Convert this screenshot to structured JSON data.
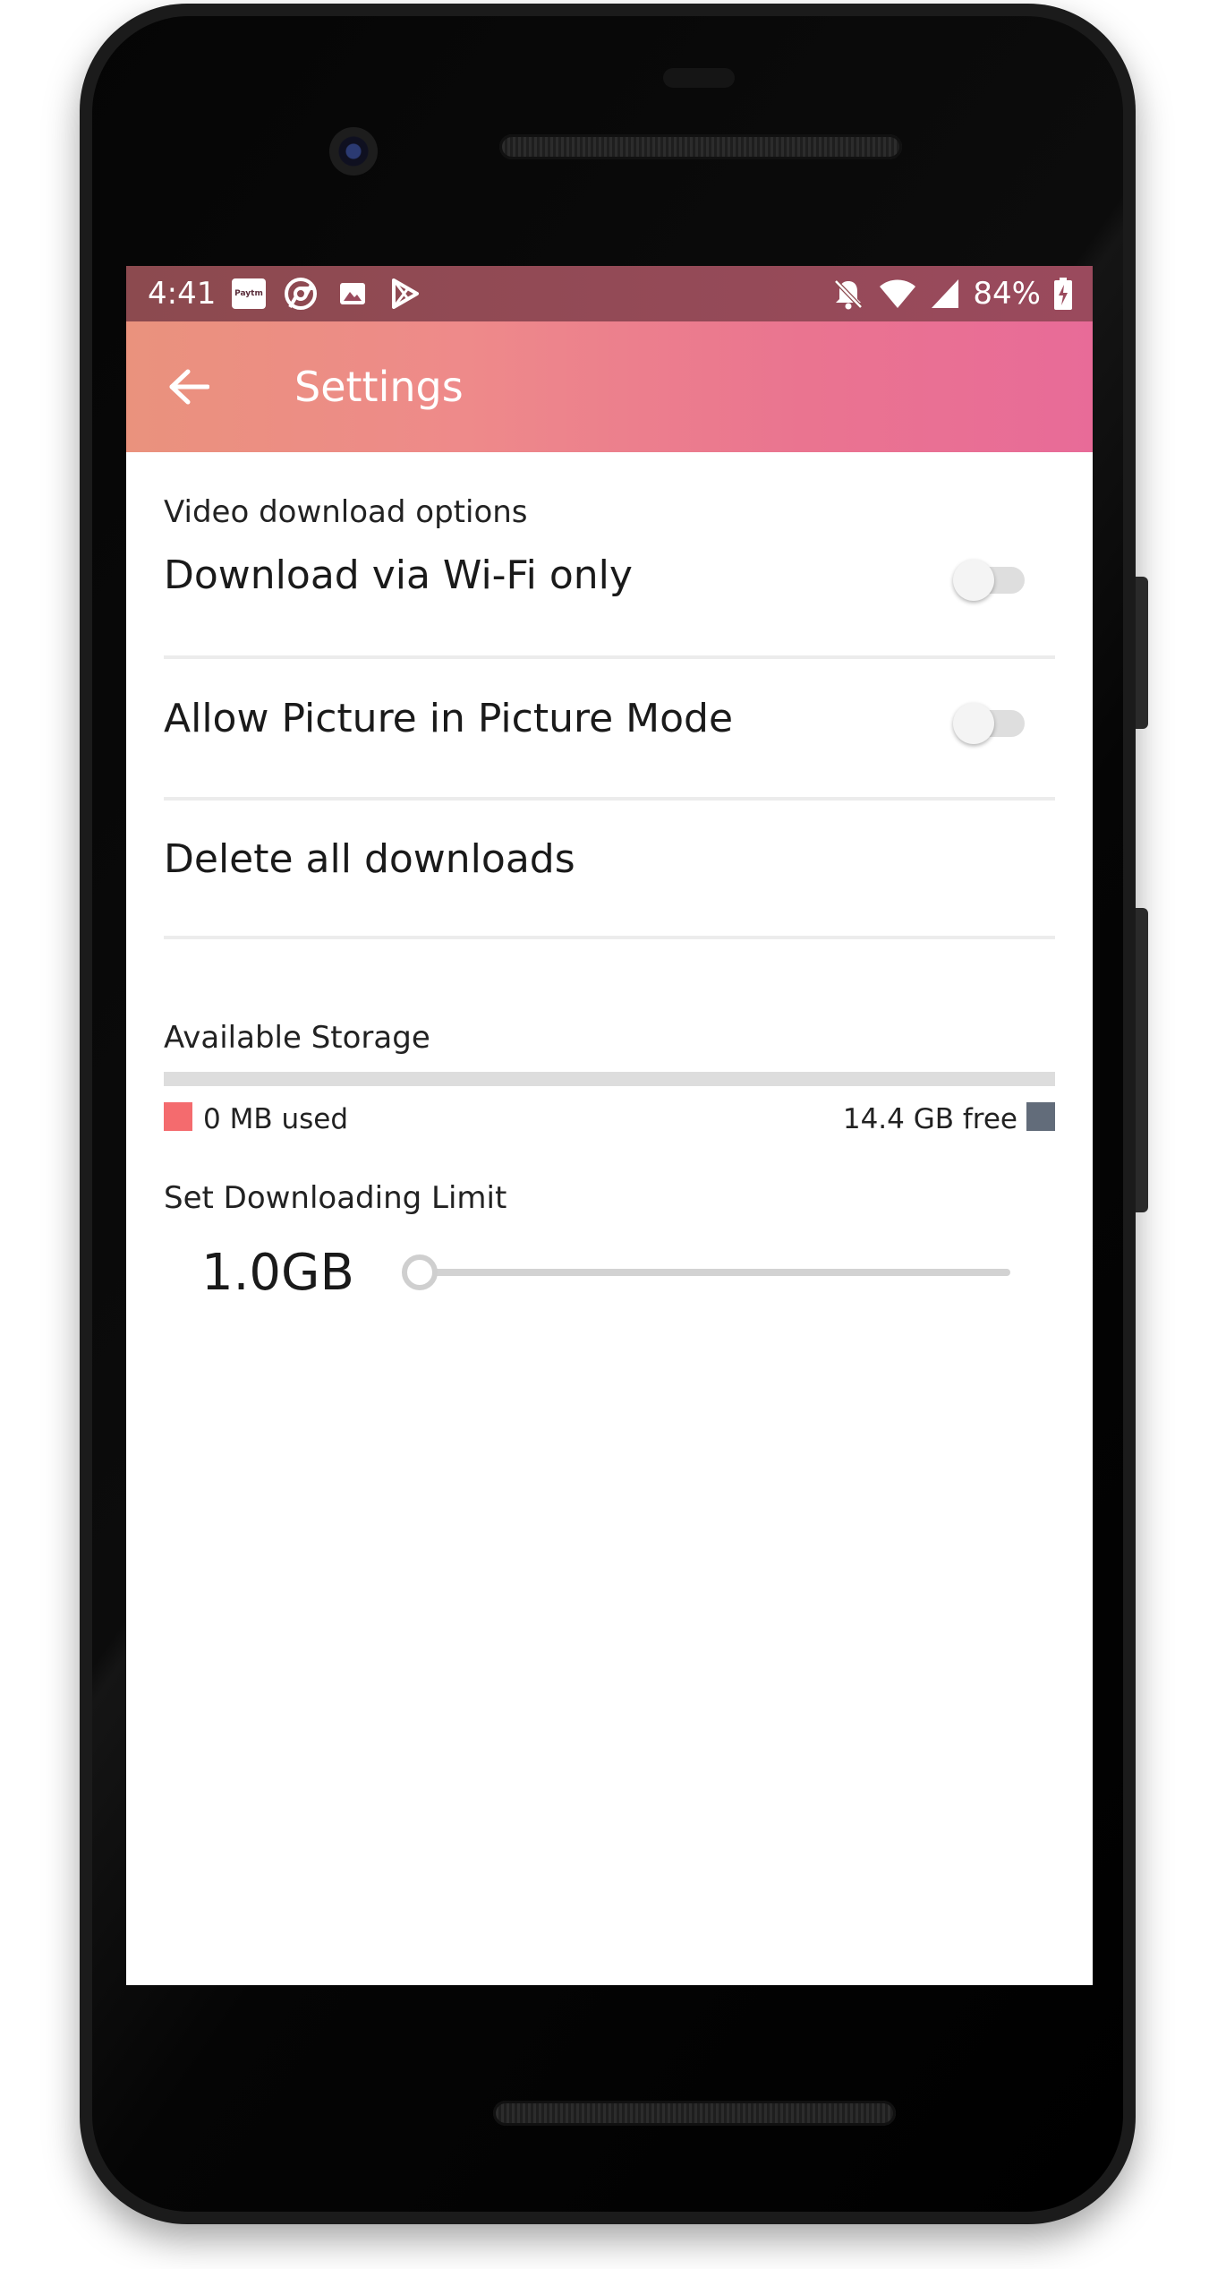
{
  "status_bar": {
    "time": "4:41",
    "left_icons": [
      "paytm-icon",
      "chrome-icon",
      "image-icon",
      "play-store-icon"
    ],
    "paytm_label": "Paytm",
    "right_icons": [
      "bell-off-icon",
      "wifi-icon",
      "cell-signal-icon",
      "battery-charging-icon"
    ],
    "battery_percent": "84%"
  },
  "toolbar": {
    "back_icon": "arrow-left-icon",
    "title": "Settings",
    "gradient_colors": [
      "#ea927d",
      "#e86b98"
    ]
  },
  "video_options": {
    "section_title": "Video download options",
    "wifi_only": {
      "label": "Download via Wi-Fi only",
      "enabled": false
    },
    "picture_in_picture": {
      "label": "Allow Picture in Picture Mode",
      "enabled": false
    },
    "delete_all": {
      "label": "Delete all downloads"
    }
  },
  "storage": {
    "title": "Available Storage",
    "used_label": "0 MB used",
    "free_label": "14.4 GB free",
    "used_fraction": 0,
    "used_color": "#f46b6e",
    "free_color": "#626c7a"
  },
  "download_limit": {
    "title": "Set Downloading Limit",
    "value_label": "1.0GB",
    "slider_fraction": 0
  }
}
